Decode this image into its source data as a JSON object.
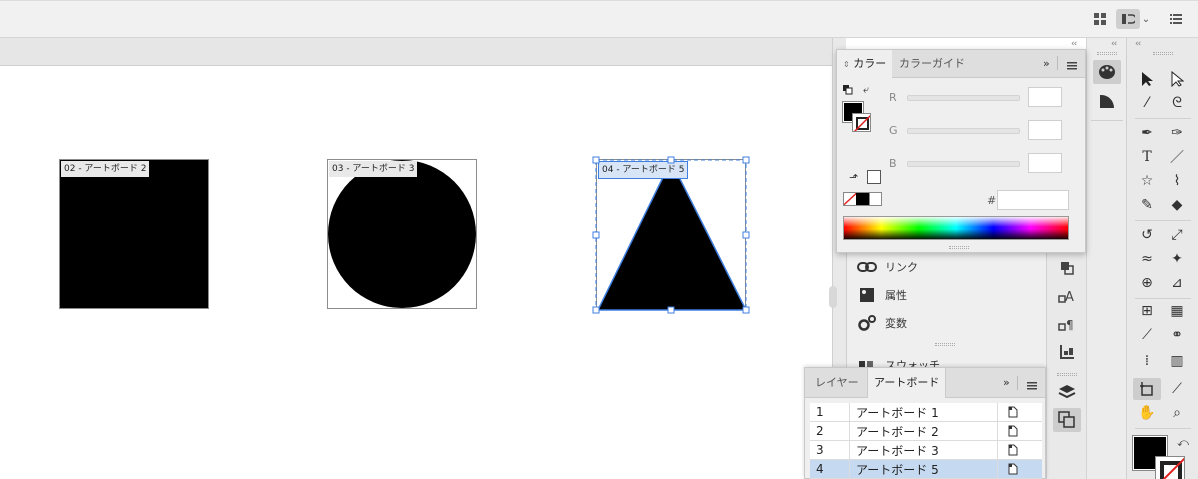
{
  "artboards_on_canvas": [
    {
      "label": "02 - アートボード 2",
      "shape": "square"
    },
    {
      "label": "03 - アートボード 3",
      "shape": "circle"
    },
    {
      "label": "04 - アートボード 5",
      "shape": "triangle"
    }
  ],
  "color_panel": {
    "tabs": [
      "カラー",
      "カラーガイド"
    ],
    "active_tab": "カラー",
    "channels": [
      "R",
      "G",
      "B"
    ],
    "hex_label": "#",
    "hex_value": "",
    "fill_color": "#000000"
  },
  "mid_panel": {
    "items": [
      {
        "label": "リンク",
        "icon": "link-icon"
      },
      {
        "label": "属性",
        "icon": "attributes-icon"
      },
      {
        "label": "変数",
        "icon": "variables-icon"
      },
      {
        "label": "スウォッチ",
        "icon": "swatches-icon"
      }
    ]
  },
  "artboard_panel": {
    "tabs": [
      "レイヤー",
      "アートボード"
    ],
    "active_tab": "アートボード",
    "rows": [
      {
        "num": "1",
        "name": "アートボード 1",
        "selected": false
      },
      {
        "num": "2",
        "name": "アートボード 2",
        "selected": false
      },
      {
        "num": "3",
        "name": "アートボード 3",
        "selected": false
      },
      {
        "num": "4",
        "name": "アートボード 5",
        "selected": true
      }
    ]
  },
  "colors": {
    "selection_blue": "#3f7fe0",
    "row_selected": "#c5daf1",
    "fill": "#000000",
    "stroke_none": "#e02020"
  }
}
